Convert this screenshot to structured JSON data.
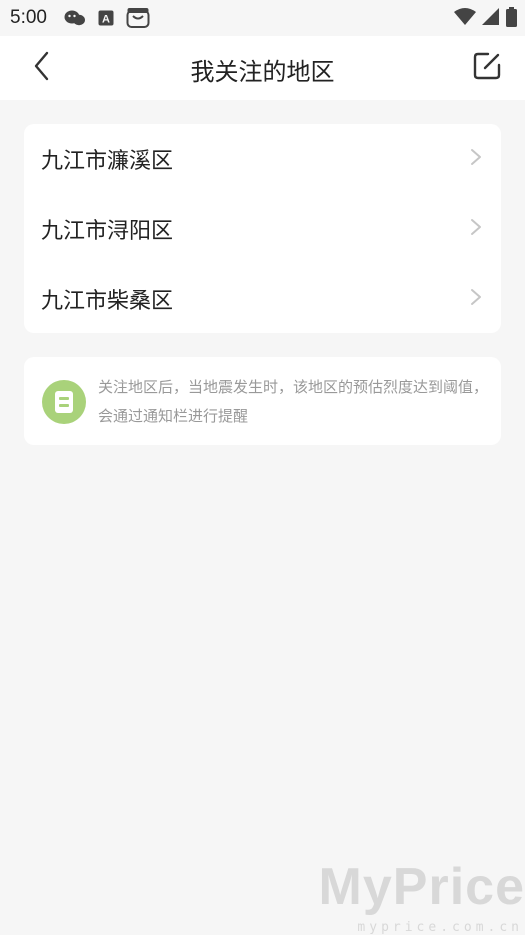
{
  "status_bar": {
    "time": "5:00",
    "icons_left": [
      "wechat-icon",
      "font-a-icon",
      "shopping-bag-icon"
    ],
    "icons_right": [
      "wifi-icon",
      "signal-icon",
      "battery-icon"
    ]
  },
  "nav": {
    "title": "我关注的地区",
    "back_icon": "chevron-left-icon",
    "edit_icon": "edit-icon"
  },
  "regions": [
    {
      "label": "九江市濂溪区"
    },
    {
      "label": "九江市浔阳区"
    },
    {
      "label": "九江市柴桑区"
    }
  ],
  "tip": {
    "text": "关注地区后，当地震发生时，该地区的预估烈度达到阈值，会通过通知栏进行提醒",
    "icon": "notice-icon",
    "icon_color": "#9ccc65"
  },
  "watermark": {
    "main": "MyPrice",
    "sub": "myprice.com.cn"
  }
}
